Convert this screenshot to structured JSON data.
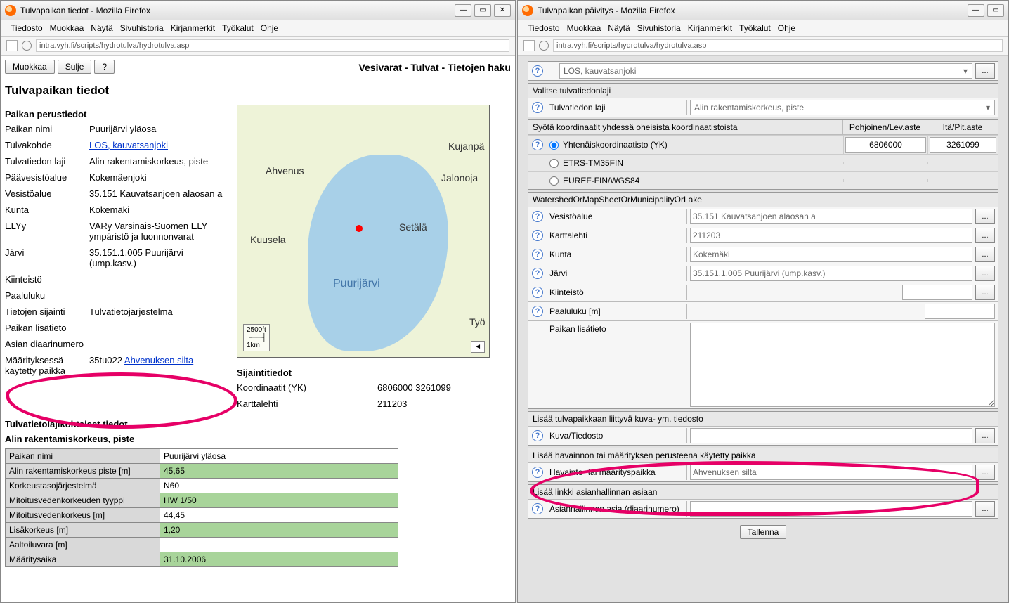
{
  "left": {
    "title": "Tulvapaikan tiedot - Mozilla Firefox",
    "url": "intra.vyh.fi/scripts/hydrotulva/hydrotulva.asp",
    "menubar": [
      "Tiedosto",
      "Muokkaa",
      "Näytä",
      "Sivuhistoria",
      "Kirjanmerkit",
      "Työkalut",
      "Ohje"
    ],
    "buttons": {
      "edit": "Muokkaa",
      "close": "Sulje",
      "help": "?"
    },
    "subtitle": "Vesivarat - Tulvat - Tietojen haku",
    "heading": "Tulvapaikan tiedot",
    "section_basic": "Paikan perustiedot",
    "rows": {
      "paikan_nimi_lbl": "Paikan nimi",
      "paikan_nimi": "Puurijärvi yläosa",
      "tulvakohde_lbl": "Tulvakohde",
      "tulvakohde": "LOS, kauvatsanjoki",
      "tulvatiedon_lbl": "Tulvatiedon laji",
      "tulvatiedon": "Alin rakentamiskorkeus, piste",
      "paavesisto_lbl": "Päävesistöalue",
      "paavesisto": "Kokemäenjoki",
      "vesistoalue_lbl": "Vesistöalue",
      "vesistoalue": "35.151 Kauvatsanjoen alaosan a",
      "kunta_lbl": "Kunta",
      "kunta": "Kokemäki",
      "elyy_lbl": "ELYy",
      "elyy": "VARy Varsinais-Suomen ELY ympäristö ja luonnonvarat",
      "jarvi_lbl": "Järvi",
      "jarvi": "35.151.1.005 Puurijärvi (ump.kasv.)",
      "kiinteisto_lbl": "Kiinteistö",
      "kiinteisto": "",
      "paaluluku_lbl": "Paaluluku",
      "paaluluku": "",
      "tietojen_lbl": "Tietojen sijainti",
      "tietojen": "Tulvatietojärjestelmä",
      "lisatieto_lbl": "Paikan lisätieto",
      "lisatieto": "",
      "asian_lbl": "Asian diaarinumero",
      "asian": "",
      "maarit_lbl": "Määrityksessä käytetty paikka",
      "maarit_id": "35tu022",
      "maarit_link": "Ahvenuksen silta"
    },
    "loc_section": "Sijaintitiedot",
    "loc": {
      "koord_lbl": "Koordinaatit (YK)",
      "koord": "6806000 3261099",
      "kartta_lbl": "Karttalehti",
      "kartta": "211203"
    },
    "tulva_heading": "Tulvatietolajikohtaiset tiedot",
    "tulva_sub": "Alin rakentamiskorkeus, piste",
    "table": [
      [
        "Paikan nimi",
        "Puurijärvi yläosa",
        "w"
      ],
      [
        "Alin rakentamiskorkeus piste [m]",
        "45,65",
        "g"
      ],
      [
        "Korkeustasojärjestelmä",
        "N60",
        "w"
      ],
      [
        "Mitoitusvedenkorkeuden tyyppi",
        "HW 1/50",
        "g"
      ],
      [
        "Mitoitusvedenkorkeus [m]",
        "44,45",
        "w"
      ],
      [
        "Lisäkorkeus [m]",
        "1,20",
        "g"
      ],
      [
        "Aaltoiluvara [m]",
        "",
        "w"
      ],
      [
        "Määritysaika",
        "31.10.2006",
        "g"
      ]
    ],
    "map_labels": {
      "puurijarvi": "Puurijärvi",
      "ahvenus": "Ahvenus",
      "kuusela": "Kuusela",
      "setala": "Setälä",
      "kujanpa": "Kujanpä",
      "jalonoja": "Jalonoja",
      "tyo": "Työ"
    },
    "map_scale": {
      "ft": "2500ft",
      "km": "1km"
    }
  },
  "right": {
    "title": "Tulvapaikan päivitys - Mozilla Firefox",
    "url": "intra.vyh.fi/scripts/hydrotulva/hydrotulva.asp",
    "menubar": [
      "Tiedosto",
      "Muokkaa",
      "Näytä",
      "Sivuhistoria",
      "Kirjanmerkit",
      "Työkalut",
      "Ohje"
    ],
    "top_row_val": "LOS, kauvatsanjoki",
    "sect_valitse": "Valitse tulvatiedonlaji",
    "tulvatiedon_lbl": "Tulvatiedon laji",
    "tulvatiedon_val": "Alin rakentamiskorkeus, piste",
    "sect_koord": "Syötä koordinaatit yhdessä oheisista koordinaatistoista",
    "coord_headers": {
      "pohj": "Pohjoinen/Lev.aste",
      "ita": "Itä/Pit.aste"
    },
    "coord_systems": {
      "yk": "Yhtenäiskoordinaatisto (YK)",
      "etrs": "ETRS-TM35FIN",
      "euref": "EUREF-FIN/WGS84"
    },
    "coord_vals": {
      "pohj": "6806000",
      "ita": "3261099"
    },
    "sect_watershed": "WatershedOrMapSheetOrMunicipalityOrLake",
    "fields": {
      "vesistoalue_lbl": "Vesistöalue",
      "vesistoalue": "35.151 Kauvatsanjoen alaosan a",
      "karttalehti_lbl": "Karttalehti",
      "karttalehti": "211203",
      "kunta_lbl": "Kunta",
      "kunta": "Kokemäki",
      "jarvi_lbl": "Järvi",
      "jarvi": "35.151.1.005 Puurijärvi (ump.kasv.)",
      "kiinteisto_lbl": "Kiinteistö",
      "kiinteisto": "",
      "paaluluku_lbl": "Paaluluku [m]",
      "paaluluku": "",
      "lisatieto_lbl": "Paikan lisätieto",
      "lisatieto": ""
    },
    "sect_lisaa_kuva": "Lisää tulvapaikkaan liittyvä kuva- ym. tiedosto",
    "kuva_lbl": "Kuva/Tiedosto",
    "kuva_val": "",
    "sect_havainto": "Lisää havainnon tai määrityksen perusteena käytetty paikka",
    "havainto_lbl": "Havainto- tai määrityspaikka",
    "havainto_val": "Ahvenuksen silta",
    "sect_linkki": "Lisää linkki asianhallinnan asiaan",
    "asia_lbl": "Asianhallinnan asia (diaarinumero)",
    "asia_val": "",
    "save": "Tallenna",
    "dotbtn": "..."
  }
}
